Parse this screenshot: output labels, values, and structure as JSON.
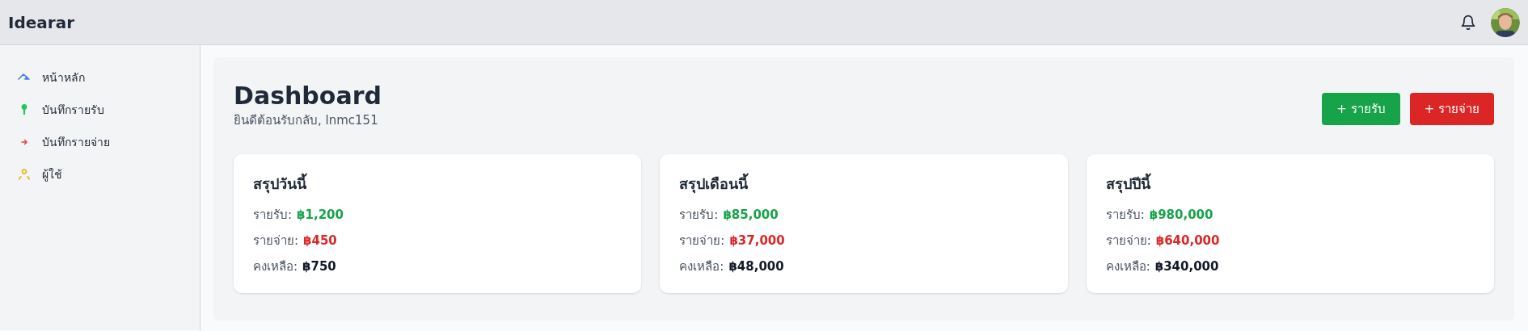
{
  "app": {
    "title": "Idearar"
  },
  "sidebar": {
    "items": [
      {
        "label": "หน้าหลัก",
        "color": "#3b82f6"
      },
      {
        "label": "บันทึกรายรับ",
        "color": "#22c55e"
      },
      {
        "label": "บันทึกรายจ่าย",
        "color": "#ef4444"
      },
      {
        "label": "ผู้ใช้",
        "color": "#eab308"
      }
    ]
  },
  "header": {
    "title": "Dashboard",
    "subtitle": "ยินดีต้อนรับกลับ, lnmc151"
  },
  "actions": [
    {
      "label": "+ รายรับ",
      "kind": "income"
    },
    {
      "label": "+ รายจ่าย",
      "kind": "expense"
    }
  ],
  "cards": [
    {
      "title": "สรุปวันนี้",
      "lines": [
        {
          "label": "รายรับ:",
          "value": "฿1,200",
          "kind": "income"
        },
        {
          "label": "รายจ่าย:",
          "value": "฿450",
          "kind": "expense"
        },
        {
          "label": "คงเหลือ:",
          "value": "฿750",
          "kind": "balance"
        }
      ]
    },
    {
      "title": "สรุปเดือนนี้",
      "lines": [
        {
          "label": "รายรับ:",
          "value": "฿85,000",
          "kind": "income"
        },
        {
          "label": "รายจ่าย:",
          "value": "฿37,000",
          "kind": "expense"
        },
        {
          "label": "คงเหลือ:",
          "value": "฿48,000",
          "kind": "balance"
        }
      ]
    },
    {
      "title": "สรุปปีนี้",
      "lines": [
        {
          "label": "รายรับ:",
          "value": "฿980,000",
          "kind": "income"
        },
        {
          "label": "รายจ่าย:",
          "value": "฿640,000",
          "kind": "expense"
        },
        {
          "label": "คงเหลือ:",
          "value": "฿340,000",
          "kind": "balance"
        }
      ]
    }
  ]
}
